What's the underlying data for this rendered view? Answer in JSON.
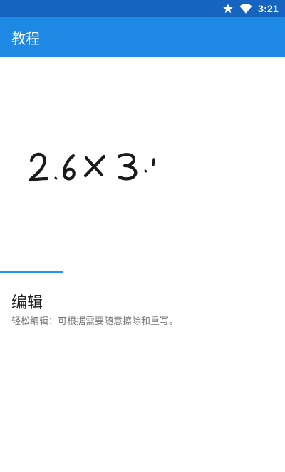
{
  "status_bar": {
    "time": "3:21",
    "icons": [
      "star-icon",
      "wifi-icon"
    ]
  },
  "app_bar": {
    "title": "教程"
  },
  "demo": {
    "handwriting_text": "2.6×3.1",
    "progress": 0.22
  },
  "section": {
    "title": "编辑",
    "description": "轻松编辑：可根据需要随意擦除和重写。"
  },
  "colors": {
    "status_bar": "#1565c0",
    "app_bar": "#1e88e5",
    "accent": "#2196f3",
    "ink": "#1a1a1a"
  }
}
